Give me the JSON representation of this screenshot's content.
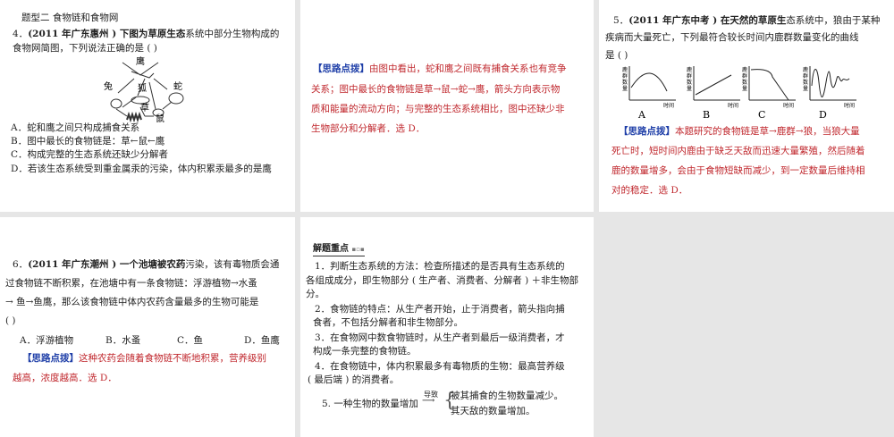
{
  "p1": {
    "section": "题型二  食物链和食物网",
    "q_num": "4．",
    "q_src": "(2011  年广东惠州 ) 下图为草原生态",
    "q_rest": "系统中部分生物构成的",
    "q_line2": "食物网简图，下列说法正确的是 (   )",
    "diagram": {
      "eagle": "鹰",
      "rabbit": "兔",
      "fox": "狐",
      "snake": "蛇",
      "grass": "草",
      "mouse": "鼠"
    },
    "options": [
      "A．蛇和鹰之间只构成捕食关系",
      "B．图中最长的食物链是：草←鼠←鹰",
      "C．构成完整的生态系统还缺少分解者",
      "D．若该生态系统受到重金属汞的污染，体内积累汞最多的是鹰"
    ]
  },
  "p2": {
    "tag": "【思路点拨】",
    "lines": [
      "由图中看出，蛇和鹰之间既有捕食关系也有竞争",
      "关系；图中最长的食物链是草→鼠→蛇→鹰，箭头方向表示物",
      "质和能量的流动方向；与完整的生态系统相比，图中还缺少非",
      "生物部分和分解者．选  D．"
    ]
  },
  "p3": {
    "q_num": "5．",
    "q_src": "(2011  年广东中考 ) 在天然的草原生",
    "q_rest": "态系统中，狼由于某种",
    "q_line2": "疾病而大量死亡，下列最符合较长时间内鹿群数量变化的曲线",
    "q_line3": "是 (   )",
    "charts": {
      "ylabel": [
        "鹿",
        "群",
        "数",
        "量"
      ],
      "xlabel": "时间",
      "labels": [
        "A",
        "B",
        "C",
        "D"
      ]
    },
    "tag": "【思路点拨】",
    "lines": [
      "本题研究的食物链是草→鹿群→狼，当狼大量",
      "死亡时，短时间内鹿由于缺乏天敌而迅速大量繁殖，然后随着",
      "鹿的数量增多，会由于食物短缺而减少，到一定数量后维持相",
      "对的稳定．选  D．"
    ]
  },
  "p4": {
    "q_num": "6．",
    "q_src": "(2011  年广东潮州 ) 一个池塘被农药",
    "q_rest": "污染，该有毒物质会通",
    "lines": [
      "过食物链不断积累，在池塘中有一条食物链：浮游植物→水蚤",
      "→ 鱼→鱼鹰，那么该食物链中体内农药含量最多的生物可能是",
      "(   )"
    ],
    "options": [
      "A．浮游植物",
      "B．水蚤",
      "C．鱼",
      "D．鱼鹰"
    ],
    "tag": "【思路点拨】",
    "hint": [
      "这种农药会随着食物链不断地积累，营养级别",
      "越高，浓度越高．选  D．"
    ]
  },
  "p5": {
    "title": "解题重点",
    "lines": [
      "1．判断生态系统的方法：检查所描述的是否具有生态系统的",
      "各组成成分，即生物部分 ( 生产者、消费者、分解者 ) ＋非生物部",
      "分。",
      "2．食物链的特点：从生产者开始，止于消费者，箭头指向捕",
      "食者，不包括分解者和非生物部分。",
      "3．在食物网中数食物链时，从生产者到最后一级消费者，才",
      "构成一条完整的食物链。",
      "4．在食物链中，体内积累最多有毒物质的生物：最高营养级",
      "( 最后端 ) 的消费者。"
    ],
    "item5": {
      "left": "5. 一种生物的数量增加",
      "arrow": "导致",
      "r1": "被其捕食的生物数量减少。",
      "r2": "其天敌的数量增加。"
    }
  }
}
